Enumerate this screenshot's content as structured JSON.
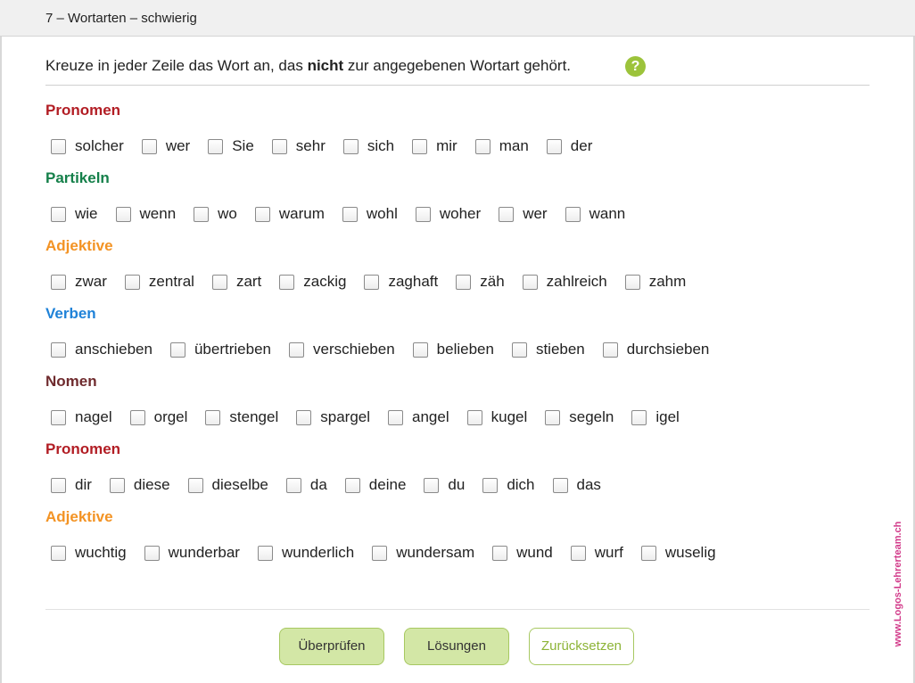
{
  "window": {
    "title": "7 – Wortarten – schwierig"
  },
  "instruction": {
    "before": "Kreuze in jeder Zeile das Wort an, das ",
    "emphasis": "nicht",
    "after": " zur angegebenen Wortart gehört.",
    "help_glyph": "?"
  },
  "colors": {
    "Pronomen": "#b21d24",
    "Partikeln": "#15804a",
    "Adjektive": "#f39324",
    "Verben": "#1f82d8",
    "Nomen": "#6f2b2e",
    "accent_green": "#9cc33b",
    "watermark": "#d23b8a"
  },
  "sections": [
    {
      "category": "Pronomen",
      "color": "#b21d24",
      "words": [
        "solcher",
        "wer",
        "Sie",
        "sehr",
        "sich",
        "mir",
        "man",
        "der"
      ]
    },
    {
      "category": "Partikeln",
      "color": "#15804a",
      "words": [
        "wie",
        "wenn",
        "wo",
        "warum",
        "wohl",
        "woher",
        "wer",
        "wann"
      ]
    },
    {
      "category": "Adjektive",
      "color": "#f39324",
      "words": [
        "zwar",
        "zentral",
        "zart",
        "zackig",
        "zaghaft",
        "zäh",
        "zahlreich",
        "zahm"
      ]
    },
    {
      "category": "Verben",
      "color": "#1f82d8",
      "words": [
        "anschieben",
        "übertrieben",
        "verschieben",
        "belieben",
        "stieben",
        "durchsieben"
      ]
    },
    {
      "category": "Nomen",
      "color": "#6f2b2e",
      "words": [
        "nagel",
        "orgel",
        "stengel",
        "spargel",
        "angel",
        "kugel",
        "segeln",
        "igel"
      ]
    },
    {
      "category": "Pronomen",
      "color": "#b21d24",
      "words": [
        "dir",
        "diese",
        "dieselbe",
        "da",
        "deine",
        "du",
        "dich",
        "das"
      ]
    },
    {
      "category": "Adjektive",
      "color": "#f39324",
      "words": [
        "wuchtig",
        "wunderbar",
        "wunderlich",
        "wundersam",
        "wund",
        "wurf",
        "wuselig"
      ]
    }
  ],
  "buttons": {
    "check": "Überprüfen",
    "solutions": "Lösungen",
    "reset": "Zurücksetzen"
  },
  "watermark": "www.Logos-Lehrerteam.ch"
}
